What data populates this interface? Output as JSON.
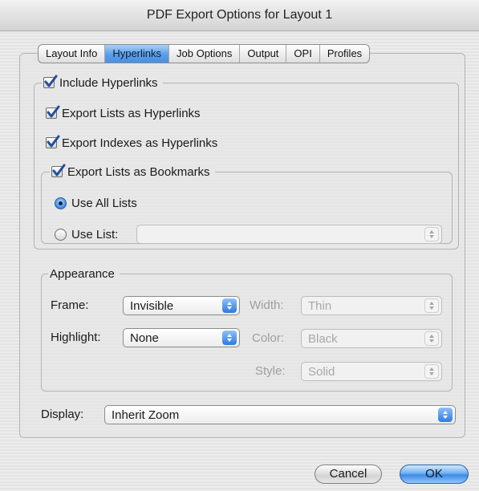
{
  "window": {
    "title": "PDF Export Options for Layout 1"
  },
  "tabs": [
    {
      "label": "Layout Info"
    },
    {
      "label": "Hyperlinks"
    },
    {
      "label": "Job Options"
    },
    {
      "label": "Output"
    },
    {
      "label": "OPI"
    },
    {
      "label": "Profiles"
    }
  ],
  "active_tab": "Hyperlinks",
  "hyperlinks": {
    "include_hyperlinks": {
      "label": "Include Hyperlinks",
      "checked": true
    },
    "export_lists": {
      "label": "Export Lists as Hyperlinks",
      "checked": true
    },
    "export_indexes": {
      "label": "Export Indexes as Hyperlinks",
      "checked": true
    },
    "bookmarks": {
      "label": "Export Lists as Bookmarks",
      "checked": true,
      "use_all_lists": {
        "label": "Use All Lists",
        "selected": true
      },
      "use_list": {
        "label": "Use List:",
        "selected": false,
        "value": ""
      }
    }
  },
  "appearance": {
    "legend": "Appearance",
    "frame": {
      "label": "Frame:",
      "value": "Invisible"
    },
    "highlight": {
      "label": "Highlight:",
      "value": "None"
    },
    "width": {
      "label": "Width:",
      "value": "Thin"
    },
    "color": {
      "label": "Color:",
      "value": "Black"
    },
    "style": {
      "label": "Style:",
      "value": "Solid"
    }
  },
  "display": {
    "label": "Display:",
    "value": "Inherit Zoom"
  },
  "buttons": {
    "cancel": "Cancel",
    "ok": "OK"
  },
  "colors": {
    "accent": "#4a90e0",
    "checkmark": "#1f4f99"
  }
}
